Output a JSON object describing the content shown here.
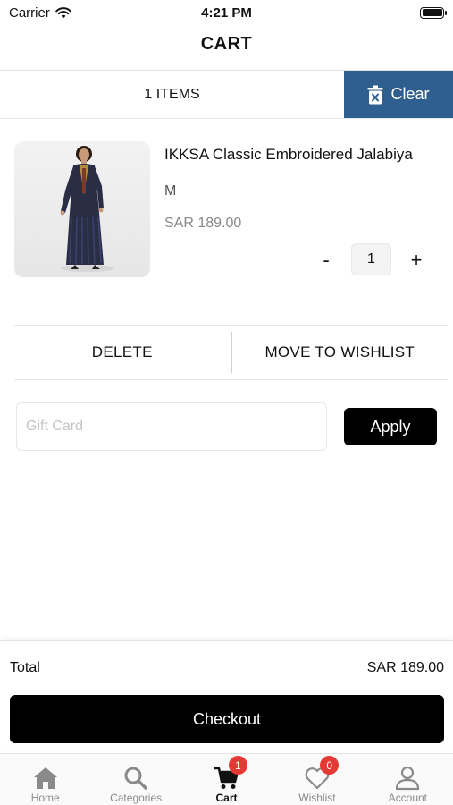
{
  "status_bar": {
    "carrier": "Carrier",
    "time": "4:21 PM"
  },
  "nav": {
    "title": "CART"
  },
  "cart_header": {
    "items_count": "1 ITEMS",
    "clear_label": "Clear"
  },
  "item": {
    "name": "IKKSA Classic Embroidered Jalabiya",
    "size": "M",
    "price": "SAR 189.00",
    "quantity": "1",
    "minus_label": "-",
    "plus_label": "+"
  },
  "actions": {
    "delete_label": "DELETE",
    "wishlist_label": "MOVE TO WISHLIST"
  },
  "gift_card": {
    "placeholder": "Gift Card",
    "apply_label": "Apply"
  },
  "summary": {
    "total_label": "Total",
    "total_value": "SAR 189.00",
    "checkout_label": "Checkout"
  },
  "tab_bar": {
    "tabs": [
      {
        "label": "Home",
        "icon": "home-icon"
      },
      {
        "label": "Categories",
        "icon": "search-icon"
      },
      {
        "label": "Cart",
        "icon": "cart-icon",
        "badge": "1"
      },
      {
        "label": "Wishlist",
        "icon": "heart-icon",
        "badge": "0"
      },
      {
        "label": "Account",
        "icon": "person-icon"
      }
    ]
  },
  "colors": {
    "accent": "#2f5f8f",
    "badge": "#e53935",
    "primary_button": "#000000"
  }
}
